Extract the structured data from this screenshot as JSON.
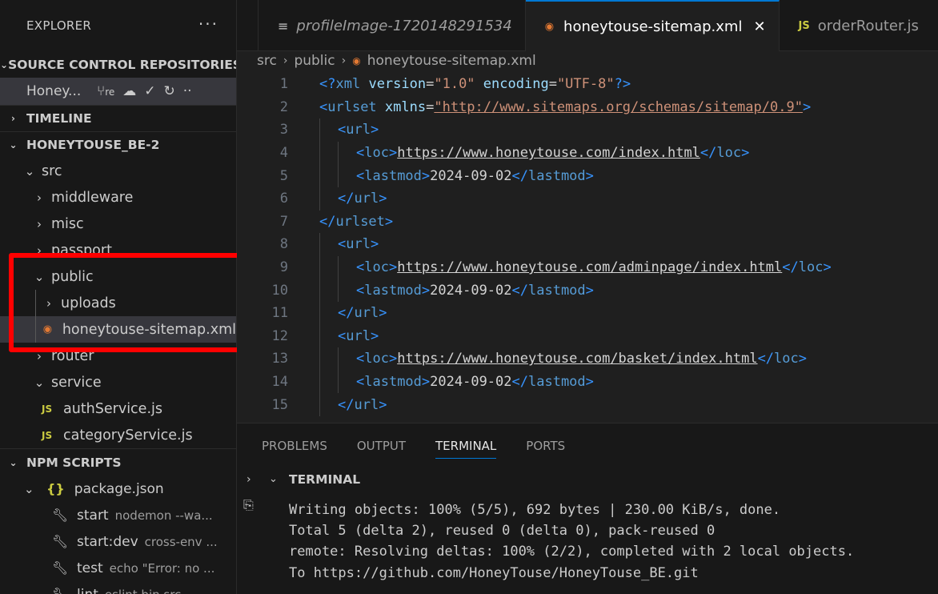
{
  "sidebar": {
    "title": "EXPLORER",
    "more": "···",
    "source_control": {
      "label": "SOURCE CONTROL REPOSITORIES",
      "repo": "Honey...",
      "branch": "re"
    },
    "timeline": "TIMELINE",
    "workspace": "HONEYTOUSE_BE-2",
    "tree": [
      {
        "label": "src"
      },
      {
        "label": "middleware"
      },
      {
        "label": "misc"
      },
      {
        "label": "passport"
      },
      {
        "label": "public"
      },
      {
        "label": "uploads"
      },
      {
        "label": "honeytouse-sitemap.xml"
      },
      {
        "label": "router"
      },
      {
        "label": "service"
      },
      {
        "label": "authService.js"
      },
      {
        "label": "categoryService.js"
      }
    ],
    "npm": {
      "label": "NPM SCRIPTS",
      "package": "package.json",
      "scripts": [
        {
          "name": "start",
          "cmd": "nodemon --wa..."
        },
        {
          "name": "start:dev",
          "cmd": "cross-env ..."
        },
        {
          "name": "test",
          "cmd": "echo \"Error: no ..."
        },
        {
          "name": "lint",
          "cmd": "eslint bin src"
        }
      ]
    }
  },
  "tabs": [
    {
      "label": "profileImage-1720148291534"
    },
    {
      "label": "honeytouse-sitemap.xml",
      "close": "✕"
    },
    {
      "label": "orderRouter.js"
    }
  ],
  "breadcrumb": [
    "src",
    "public",
    "honeytouse-sitemap.xml"
  ],
  "code": {
    "line_numbers": [
      "1",
      "2",
      "3",
      "4",
      "5",
      "6",
      "7",
      "8",
      "9",
      "10",
      "11",
      "12",
      "13",
      "14",
      "15"
    ],
    "decl": {
      "open": "<?",
      "name": "xml",
      "a1": "version",
      "v1": "\"1.0\"",
      "a2": "encoding",
      "v2": "\"UTF-8\"",
      "close": "?>"
    },
    "urlset_open": {
      "tag": "urlset",
      "attr": "xmlns",
      "value": "\"http://www.sitemaps.org/schemas/sitemap/0.9\""
    },
    "urls": [
      {
        "loc": "https://www.honeytouse.com/index.html",
        "lastmod": "2024-09-02"
      },
      {
        "loc": "https://www.honeytouse.com/adminpage/index.html",
        "lastmod": "2024-09-02"
      },
      {
        "loc": "https://www.honeytouse.com/basket/index.html",
        "lastmod": "2024-09-02"
      }
    ],
    "tags": {
      "url": "url",
      "loc": "loc",
      "lastmod": "lastmod",
      "urlset": "urlset"
    }
  },
  "panel": {
    "tabs": [
      "PROBLEMS",
      "OUTPUT",
      "TERMINAL",
      "PORTS"
    ],
    "active_tab": "TERMINAL",
    "terminal_header": "TERMINAL",
    "terminal_lines": [
      "Writing objects: 100% (5/5), 692 bytes | 230.00 KiB/s, done.",
      "Total 5 (delta 2), reused 0 (delta 0), pack-reused 0",
      "remote: Resolving deltas: 100% (2/2), completed with 2 local objects.",
      "To https://github.com/HoneyTouse/HoneyTouse_BE.git"
    ]
  },
  "colors": {
    "accent": "#0078d4",
    "highlight_box": "#ff0000"
  }
}
